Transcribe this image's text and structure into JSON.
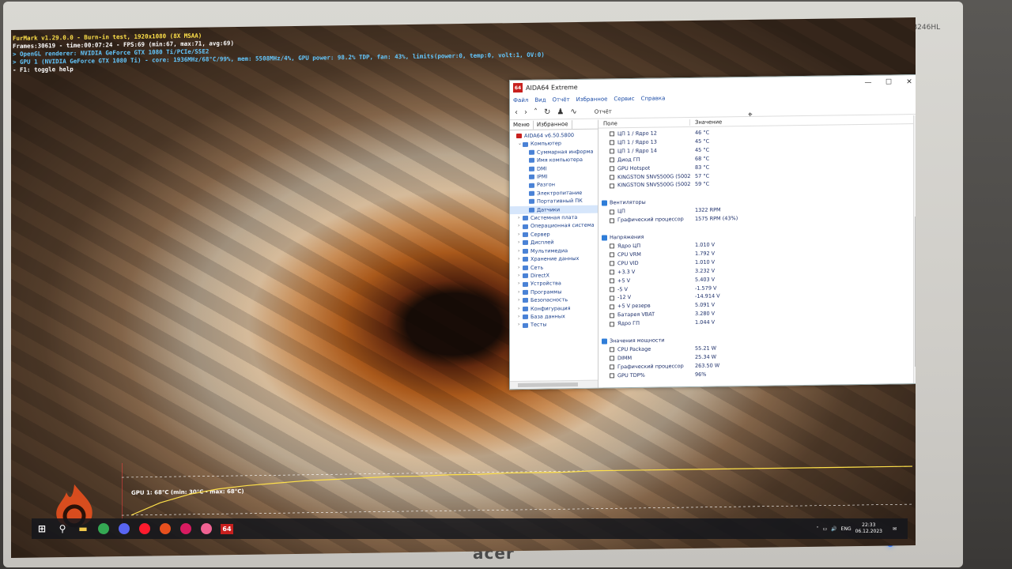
{
  "monitor": {
    "model": "B246HL",
    "brand": "acer"
  },
  "furmark": {
    "lines": [
      "FurMark v1.29.0.0 - Burn-in test, 1920x1080 (8X MSAA)",
      "Frames:30619 - time:00:07:24 - FPS:69 (min:67, max:71, avg:69)",
      "> OpenGL renderer: NVIDIA GeForce GTX 1080 Ti/PCIe/SSE2",
      "> GPU 1 (NVIDIA GeForce GTX 1080 Ti) - core: 1936MHz/68°C/99%, mem: 5508MHz/4%, GPU power: 98.2% TDP, fan: 43%, limits(power:0, temp:0, volt:1, OV:0)",
      "- F1: toggle help"
    ],
    "graph_label": "GPU 1: 68°C (min: 30°C - max: 68°C)",
    "gpu_temp_series": [
      30,
      42,
      50,
      55,
      58,
      60,
      62,
      63,
      64,
      65,
      65,
      66,
      66,
      67,
      67,
      67,
      68,
      68,
      68,
      68,
      68,
      68,
      68,
      68,
      68,
      68,
      68,
      68
    ],
    "colors": {
      "title": "#ffe14a",
      "info": "#ffffff",
      "detail": "#64c8ff"
    }
  },
  "aida": {
    "title": "AIDA64 Extreme",
    "app_badge": "64",
    "window_controls": [
      "—",
      "☐",
      "✕"
    ],
    "menu": [
      "Файл",
      "Вид",
      "Отчёт",
      "Избранное",
      "Сервис",
      "Справка"
    ],
    "toolbar": {
      "icons": [
        "‹",
        "›",
        "˄",
        "↻",
        "♟",
        "∿"
      ],
      "report_label": "Отчёт"
    },
    "left_tabs": [
      "Меню",
      "Избранное"
    ],
    "tree": [
      {
        "label": "AIDA64 v6.50.5800",
        "level": 0,
        "exp": ""
      },
      {
        "label": "Компьютер",
        "level": 1,
        "exp": "⌄"
      },
      {
        "label": "Суммарная информа",
        "level": 2,
        "exp": ""
      },
      {
        "label": "Имя компьютера",
        "level": 2,
        "exp": ""
      },
      {
        "label": "DMI",
        "level": 2,
        "exp": ""
      },
      {
        "label": "IPMI",
        "level": 2,
        "exp": ""
      },
      {
        "label": "Разгон",
        "level": 2,
        "exp": ""
      },
      {
        "label": "Электропитание",
        "level": 2,
        "exp": ""
      },
      {
        "label": "Портативный ПК",
        "level": 2,
        "exp": ""
      },
      {
        "label": "Датчики",
        "level": 2,
        "exp": "",
        "selected": true
      },
      {
        "label": "Системная плата",
        "level": 1,
        "exp": "›"
      },
      {
        "label": "Операционная система",
        "level": 1,
        "exp": "›"
      },
      {
        "label": "Сервер",
        "level": 1,
        "exp": "›"
      },
      {
        "label": "Дисплей",
        "level": 1,
        "exp": "›"
      },
      {
        "label": "Мультимедиа",
        "level": 1,
        "exp": "›"
      },
      {
        "label": "Хранение данных",
        "level": 1,
        "exp": "›"
      },
      {
        "label": "Сеть",
        "level": 1,
        "exp": "›"
      },
      {
        "label": "DirectX",
        "level": 1,
        "exp": "›"
      },
      {
        "label": "Устройства",
        "level": 1,
        "exp": "›"
      },
      {
        "label": "Программы",
        "level": 1,
        "exp": "›"
      },
      {
        "label": "Безопасность",
        "level": 1,
        "exp": "›"
      },
      {
        "label": "Конфигурация",
        "level": 1,
        "exp": "›"
      },
      {
        "label": "База данных",
        "level": 1,
        "exp": "›"
      },
      {
        "label": "Тесты",
        "level": 1,
        "exp": "›"
      }
    ],
    "columns": [
      "Поле",
      "Значение"
    ],
    "temps": [
      {
        "f": "ЦП 1 / Ядро 12",
        "v": "46 °C"
      },
      {
        "f": "ЦП 1 / Ядро 13",
        "v": "45 °C"
      },
      {
        "f": "ЦП 1 / Ядро 14",
        "v": "45 °C"
      },
      {
        "f": "Диод ГП",
        "v": "68 °C"
      },
      {
        "f": "GPU Hotspot",
        "v": "83 °C"
      },
      {
        "f": "KINGSTON SNVS500G (50026...",
        "v": "57 °C"
      },
      {
        "f": "KINGSTON SNVS500G (50026...",
        "v": "59 °C"
      }
    ],
    "fans_title": "Вентиляторы",
    "fans": [
      {
        "f": "ЦП",
        "v": "1322 RPM"
      },
      {
        "f": "Графический процессор",
        "v": "1575 RPM  (43%)"
      }
    ],
    "volts_title": "Напряжения",
    "volts": [
      {
        "f": "Ядро ЦП",
        "v": "1.010 V"
      },
      {
        "f": "CPU VRM",
        "v": "1.792 V"
      },
      {
        "f": "CPU VID",
        "v": "1.010 V"
      },
      {
        "f": "+3.3 V",
        "v": "3.232 V"
      },
      {
        "f": "+5 V",
        "v": "5.403 V"
      },
      {
        "f": "-5 V",
        "v": "-1.579 V"
      },
      {
        "f": "-12 V",
        "v": "-14.914 V"
      },
      {
        "f": "+5 V резерв",
        "v": "5.091 V"
      },
      {
        "f": "Батарея VBAT",
        "v": "3.280 V"
      },
      {
        "f": "Ядро ГП",
        "v": "1.044 V"
      }
    ],
    "power_title": "Значения мощности",
    "power": [
      {
        "f": "CPU Package",
        "v": "55.21 W"
      },
      {
        "f": "DIMM",
        "v": "25.34 W"
      },
      {
        "f": "Графический процессор",
        "v": "263.50 W"
      },
      {
        "f": "GPU TDP%",
        "v": "96%"
      }
    ]
  },
  "taskbar": {
    "apps": [
      {
        "name": "start-button",
        "glyph": "⊞",
        "color": "#ffffff"
      },
      {
        "name": "search-button",
        "glyph": "⚲",
        "color": "#ffffff"
      },
      {
        "name": "file-explorer",
        "glyph": "▬",
        "color": "#f2c94c"
      },
      {
        "name": "chrome",
        "glyph": "",
        "color": "#34a853"
      },
      {
        "name": "discord",
        "glyph": "",
        "color": "#5865f2"
      },
      {
        "name": "opera",
        "glyph": "",
        "color": "#ff1b2d"
      },
      {
        "name": "furmark",
        "glyph": "",
        "color": "#e8501e"
      },
      {
        "name": "msi-afterburner",
        "glyph": "",
        "color": "#d81b60"
      },
      {
        "name": "heart-app",
        "glyph": "",
        "color": "#f06292"
      },
      {
        "name": "aida64",
        "glyph": "64",
        "color": "#c8201e"
      }
    ],
    "tray": {
      "lang": "ENG",
      "time": "22:33",
      "date": "06.12.2023",
      "icons": [
        "˄",
        "▭",
        "🔊",
        "✉"
      ]
    }
  }
}
